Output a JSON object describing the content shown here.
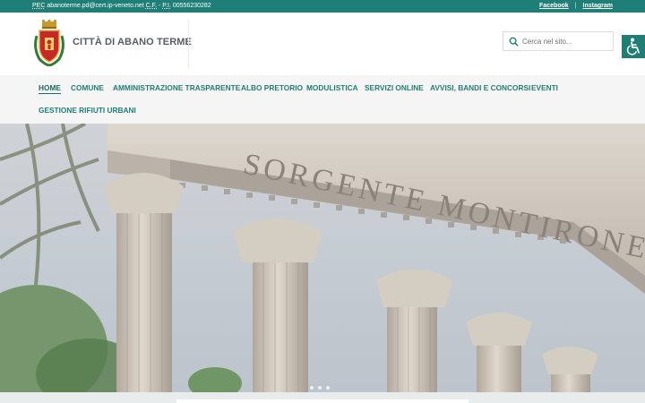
{
  "topbar": {
    "pec_label": "PEC",
    "pec_value": "abanoterme.pd@cert.ip-veneto.net",
    "cf_label": "C.F.",
    "piva_label": "P.I.",
    "piva_value": "00556230282",
    "social": [
      "Facebook",
      "Instagram"
    ],
    "separator": "|"
  },
  "header": {
    "site_name": "CITTÀ DI ABANO TERME",
    "crest_icon": "city-crest-icon",
    "search_placeholder": "Cerca nel sito...",
    "accessibility_icon": "wheelchair-icon"
  },
  "nav": {
    "items": [
      {
        "label": "HOME",
        "active": true
      },
      {
        "label": "COMUNE"
      },
      {
        "label": "AMMINISTRAZIONE TRASPARENTE"
      },
      {
        "label": "ALBO PRETORIO"
      },
      {
        "label": "MODULISTICA"
      },
      {
        "label": "SERVIZI ONLINE"
      },
      {
        "label": "AVVISI, BANDI E CONCORSI"
      },
      {
        "label": "EVENTI"
      },
      {
        "label": "GESTIONE RIFIUTI URBANI"
      }
    ]
  },
  "hero": {
    "inscription": "SORGENTE MONTIRONE",
    "slide_count": 3
  },
  "colors": {
    "brand": "#1f7f76",
    "nav_bg": "#f5f5f5"
  }
}
